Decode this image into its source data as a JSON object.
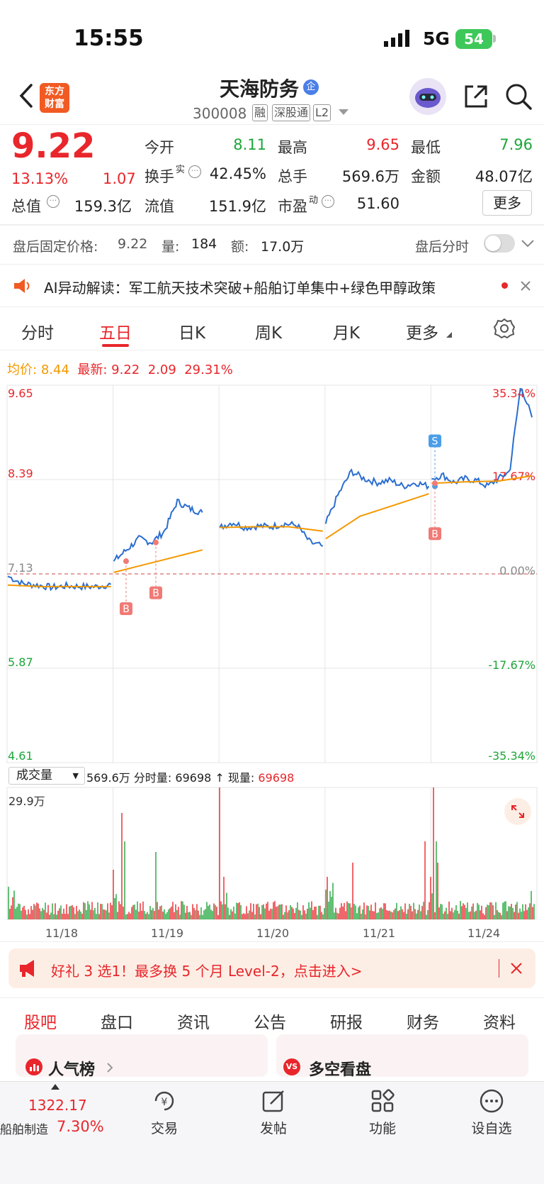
{
  "status": {
    "time": "15:55",
    "network": "5G",
    "battery": "54"
  },
  "header": {
    "stock_name": "天海防务",
    "enterprise_badge": "企",
    "code": "300008",
    "tags": [
      "融",
      "深股通",
      "L2"
    ],
    "logo_text": [
      "东方",
      "财富"
    ]
  },
  "quote": {
    "price": "9.22",
    "pct_change": "13.13%",
    "abs_change": "1.07",
    "fields": [
      {
        "label": "今开",
        "value": "8.11",
        "color": "green"
      },
      {
        "label": "最高",
        "value": "9.65",
        "color": "red"
      },
      {
        "label": "最低",
        "value": "7.96",
        "color": "green"
      },
      {
        "label": "换手",
        "value": "42.45%",
        "color": "black"
      },
      {
        "label": "总手",
        "value": "569.6万",
        "color": "black"
      },
      {
        "label": "金额",
        "value": "48.07亿",
        "color": "black"
      },
      {
        "label": "总值",
        "value": "159.3亿",
        "color": "black"
      },
      {
        "label": "流值",
        "value": "151.9亿",
        "color": "black"
      },
      {
        "label": "市盈",
        "value": "51.60",
        "color": "black"
      }
    ],
    "turnover_sup": "实",
    "pe_sup": "动",
    "more_label": "更多"
  },
  "after_hours": {
    "price_label": "盘后固定价格:",
    "price": "9.22",
    "vol_label": "量:",
    "vol": "184",
    "amt_label": "额:",
    "amt": "17.0万",
    "timeshare_label": "盘后分时"
  },
  "ai_interpret": {
    "text": "AI异动解读：军工航天技术突破+船舶订单集中+绿色甲醇政策"
  },
  "period_tabs": [
    "分时",
    "五日",
    "日K",
    "周K",
    "月K",
    "更多"
  ],
  "avg_line": {
    "avg_label": "均价:",
    "avg": "8.44",
    "latest_label": "最新:",
    "latest": "9.22",
    "chg": "2.09",
    "pct": "29.31%"
  },
  "chart_data": {
    "type": "line",
    "title": "",
    "xlabel": "",
    "ylabel": "",
    "x_categories": [
      "11/18",
      "11/19",
      "11/20",
      "11/21",
      "11/24"
    ],
    "ylim": [
      4.61,
      9.65
    ],
    "y_ticks_left": [
      "9.65",
      "8.39",
      "7.13",
      "5.87",
      "4.61"
    ],
    "y_ticks_right": [
      "35.34%",
      "17.67%",
      "0.00%",
      "-17.67%",
      "-35.34%"
    ],
    "base_price": 7.13,
    "series": [
      {
        "values_day1": [
          7.1,
          7.0,
          6.98,
          6.95,
          6.97,
          6.96,
          6.96,
          6.99
        ],
        "values_day2": [
          7.3,
          7.45,
          7.6,
          7.55,
          7.7,
          8.1,
          8.0,
          7.95
        ],
        "values_day3": [
          7.75,
          7.82,
          7.75,
          7.77,
          7.76,
          7.8,
          7.78,
          7.55,
          7.5
        ],
        "values_day4": [
          7.8,
          8.2,
          8.5,
          8.4,
          8.35,
          8.38,
          8.3,
          8.35,
          8.3
        ],
        "values_day5": [
          8.4,
          8.45,
          8.35,
          8.4,
          8.38,
          8.3,
          8.4,
          8.5,
          9.65,
          9.22
        ]
      },
      {
        "avg_day1": [
          6.98,
          6.96,
          6.96,
          6.96
        ],
        "avg_day2": [
          7.15,
          7.25,
          7.35,
          7.45
        ],
        "avg_day3": [
          7.75,
          7.76,
          7.76,
          7.7
        ],
        "avg_day4": [
          7.6,
          7.9,
          8.05,
          8.2
        ],
        "avg_day5": [
          8.34,
          8.36,
          8.37,
          8.44
        ]
      }
    ],
    "markers": [
      {
        "type": "B",
        "day": "11/19"
      },
      {
        "type": "B",
        "day": "11/19"
      },
      {
        "type": "S",
        "day": "11/24"
      },
      {
        "type": "B",
        "day": "11/24"
      }
    ]
  },
  "volume": {
    "selector": "成交量",
    "total": "569.6万",
    "timeshare_label": "分时量:",
    "timeshare": "69698",
    "current_label": "现量:",
    "current": "69698",
    "max_label": "29.9万"
  },
  "promo": {
    "text": "好礼 3 选1！最多换 5 个月 Level-2，点击进入>"
  },
  "content_tabs": [
    "股吧",
    "盘口",
    "资讯",
    "公告",
    "研报",
    "财务",
    "资料"
  ],
  "cards": {
    "left": "人气榜",
    "right": "多空看盘"
  },
  "bottom_bar": {
    "sector_index": "1322.17",
    "sector_name": "船舶制造",
    "sector_pct": "7.30%",
    "items": [
      "交易",
      "发帖",
      "功能",
      "设自选"
    ]
  },
  "colors": {
    "up": "#e8262b",
    "down": "#1ea53a",
    "accent": "#e8262b",
    "price_line": "#2b6ed0",
    "avg_line": "#f39800"
  }
}
